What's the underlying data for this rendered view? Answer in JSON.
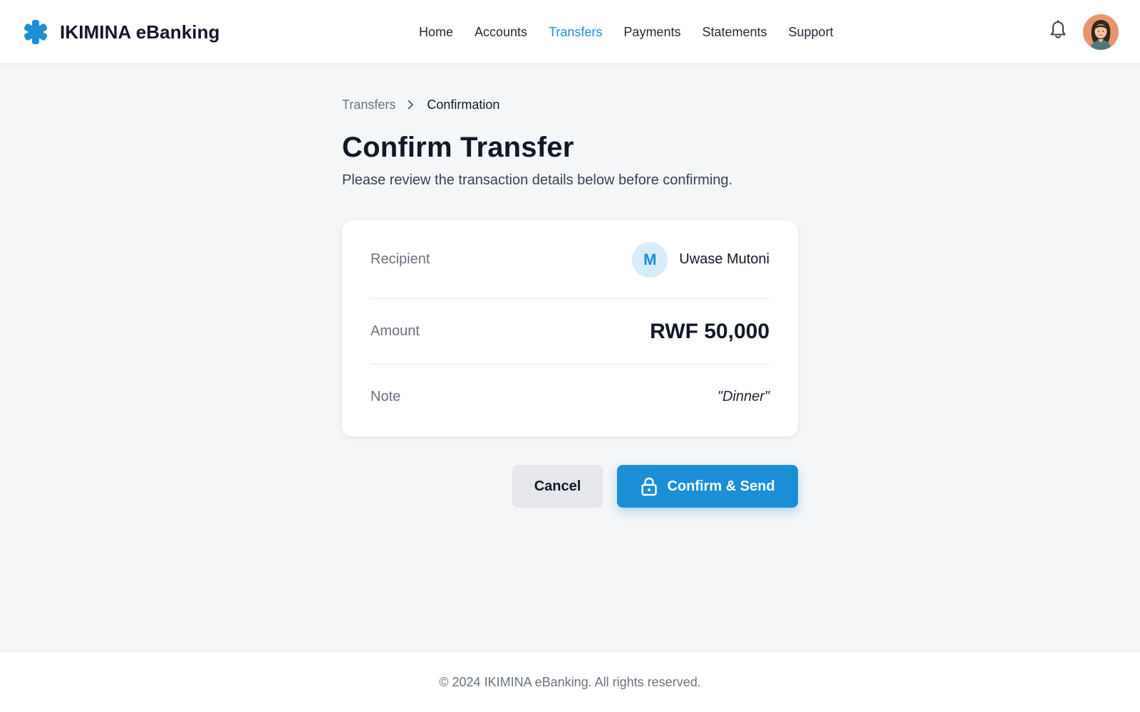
{
  "brand": {
    "name": "IKIMINA eBanking",
    "icon": "asterisk-logo-icon",
    "color": "#1a8fd6"
  },
  "nav": {
    "items": [
      {
        "label": "Home",
        "active": false
      },
      {
        "label": "Accounts",
        "active": false
      },
      {
        "label": "Transfers",
        "active": true
      },
      {
        "label": "Payments",
        "active": false
      },
      {
        "label": "Statements",
        "active": false
      },
      {
        "label": "Support",
        "active": false
      }
    ]
  },
  "header": {
    "notification_icon": "bell-icon",
    "avatar": "user-avatar"
  },
  "breadcrumb": {
    "parent": "Transfers",
    "current": "Confirmation"
  },
  "page": {
    "title": "Confirm Transfer",
    "subtitle": "Please review the transaction details below before confirming."
  },
  "details": {
    "recipient_label": "Recipient",
    "recipient_initial": "M",
    "recipient_name": "Uwase Mutoni",
    "amount_label": "Amount",
    "amount_value": "RWF 50,000",
    "note_label": "Note",
    "note_value": "\"Dinner\""
  },
  "actions": {
    "cancel_label": "Cancel",
    "confirm_label": "Confirm & Send",
    "confirm_icon": "lock-icon"
  },
  "footer": {
    "text": "© 2024 IKIMINA eBanking. All rights reserved."
  },
  "colors": {
    "accent": "#1a8fd6",
    "background": "#f4f6f8",
    "text": "#111827",
    "muted": "#6b7280"
  }
}
